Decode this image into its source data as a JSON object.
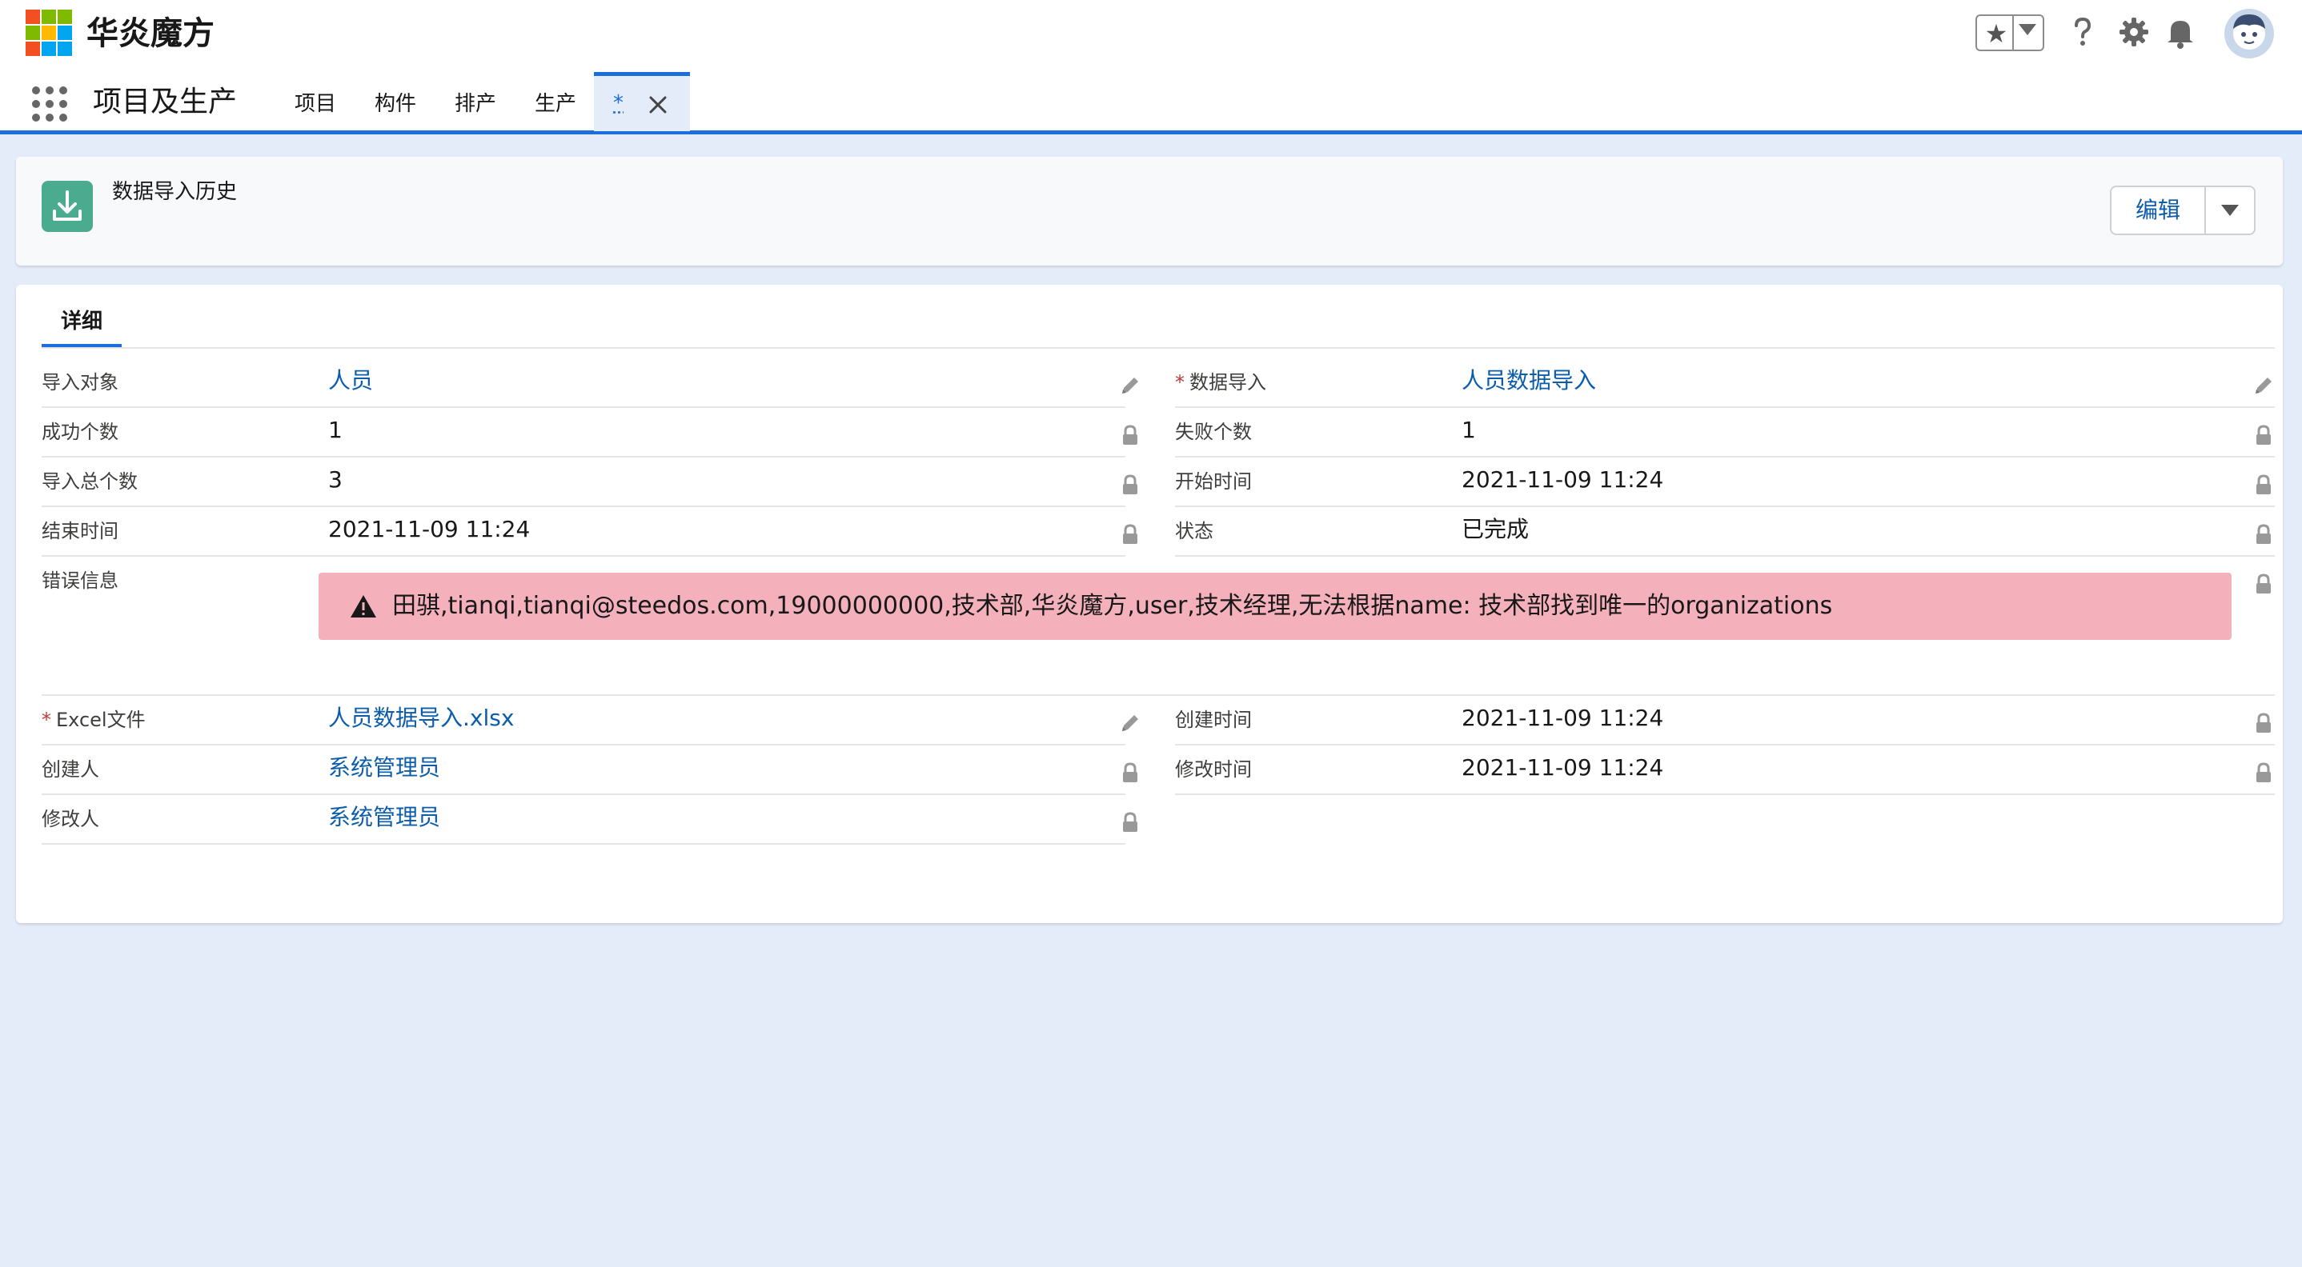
{
  "header": {
    "brand_name": "华炎魔方"
  },
  "nav": {
    "app_name": "项目及生产",
    "items": [
      "项目",
      "构件",
      "排产",
      "生产"
    ],
    "active_tab_label": "*"
  },
  "record": {
    "title": "数据导入历史",
    "edit_label": "编辑"
  },
  "detail": {
    "tab_label": "详细",
    "left": [
      {
        "label": "导入对象",
        "value": "人员",
        "required": false
      },
      {
        "label": "成功个数",
        "value": "1",
        "required": false
      },
      {
        "label": "导入总个数",
        "value": "3",
        "required": false
      },
      {
        "label": "结束时间",
        "value": "2021-11-09 11:24",
        "required": false
      }
    ],
    "right": [
      {
        "label": "数据导入",
        "value": "人员数据导入",
        "required": true
      },
      {
        "label": "失败个数",
        "value": "1",
        "required": false
      },
      {
        "label": "开始时间",
        "value": "2021-11-09 11:24",
        "required": false
      },
      {
        "label": "状态",
        "value": "已完成",
        "required": false
      }
    ],
    "error": {
      "label": "错误信息",
      "message": "田骐,tianqi,tianqi@steedos.com,19000000000,技术部,华炎魔方,user,技术经理,无法根据name: 技术部找到唯一的organizations"
    },
    "left2": [
      {
        "label": "Excel文件",
        "value": "人员数据导入.xlsx",
        "required": true
      },
      {
        "label": "创建人",
        "value": "系统管理员",
        "required": false
      },
      {
        "label": "修改人",
        "value": "系统管理员",
        "required": false
      }
    ],
    "right2": [
      {
        "label": "创建时间",
        "value": "2021-11-09 11:24",
        "required": false
      },
      {
        "label": "修改时间",
        "value": "2021-11-09 11:24",
        "required": false
      }
    ],
    "required_marker": "*"
  },
  "colors": {
    "accent": "#1b6edc",
    "link": "#0b5cab",
    "error_bg": "#f4b1bc",
    "page_bg": "#e4ecf9",
    "object_icon": "#4bab8e"
  },
  "icons": [
    "brand-logo-icon",
    "favorite-star-icon",
    "help-icon",
    "gear-icon",
    "bell-icon",
    "avatar",
    "app-launcher-icon",
    "close-icon",
    "download-icon",
    "pencil-icon",
    "lock-icon",
    "warning-icon"
  ]
}
